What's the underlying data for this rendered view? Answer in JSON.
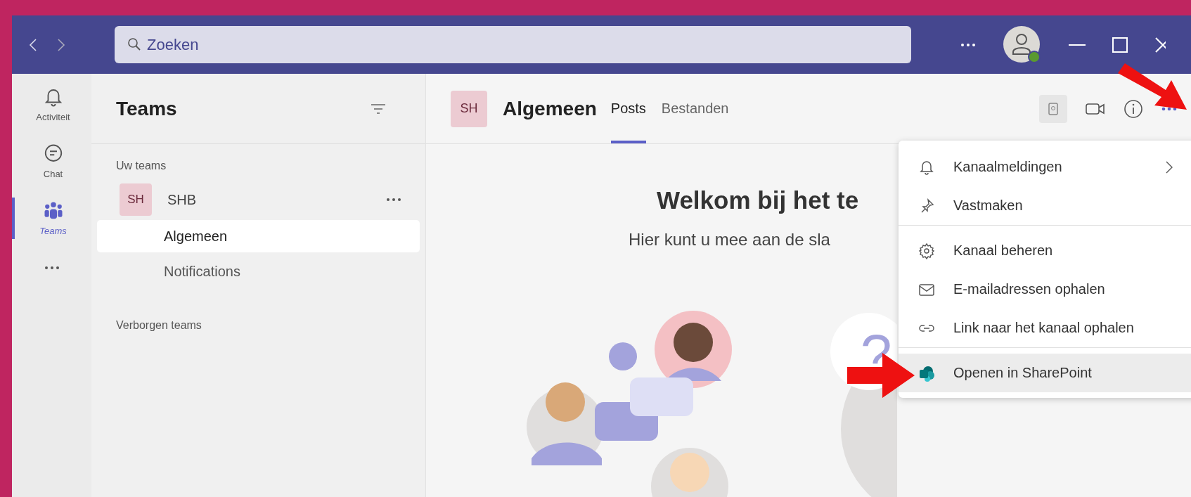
{
  "search": {
    "placeholder": "Zoeken"
  },
  "rail": [
    {
      "label": "Activiteit",
      "kind": "bell",
      "selected": false
    },
    {
      "label": "Chat",
      "kind": "chat",
      "selected": false
    },
    {
      "label": "Teams",
      "kind": "teams",
      "selected": true
    }
  ],
  "teams_panel": {
    "title": "Teams",
    "section": "Uw teams",
    "teams": [
      {
        "avatar": "SH",
        "name": "SHB",
        "channels": [
          {
            "name": "Algemeen",
            "selected": true
          },
          {
            "name": "Notifications",
            "selected": false
          }
        ]
      }
    ],
    "hidden_section": "Verborgen teams"
  },
  "channel_header": {
    "avatar": "SH",
    "title": "Algemeen",
    "tabs": [
      {
        "label": "Posts",
        "selected": true
      },
      {
        "label": "Bestanden",
        "selected": false
      }
    ]
  },
  "welcome": {
    "heading": "Welkom bij het te",
    "subtitle": "Hier kunt u mee aan de sla",
    "illustration_mark": "?"
  },
  "menu": {
    "items": [
      {
        "kind": "bell",
        "label": "Kanaalmeldingen",
        "submenu": true,
        "selected": false,
        "divider_after": false
      },
      {
        "kind": "pin",
        "label": "Vastmaken",
        "submenu": false,
        "selected": false,
        "divider_after": true
      },
      {
        "kind": "gear",
        "label": "Kanaal beheren",
        "submenu": false,
        "selected": false,
        "divider_after": false
      },
      {
        "kind": "mail",
        "label": "E-mailadressen ophalen",
        "submenu": false,
        "selected": false,
        "divider_after": false
      },
      {
        "kind": "link",
        "label": "Link naar het kanaal ophalen",
        "submenu": false,
        "selected": false,
        "divider_after": true
      },
      {
        "kind": "sharepoint",
        "label": "Openen in SharePoint",
        "submenu": false,
        "selected": true,
        "divider_after": false
      }
    ]
  }
}
